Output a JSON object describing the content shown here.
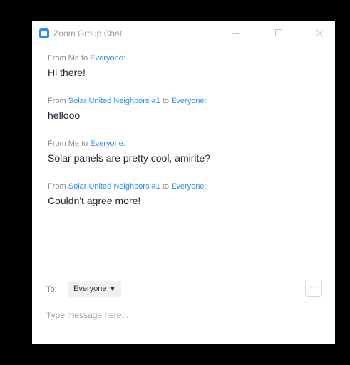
{
  "window": {
    "title": "Zoom Group Chat",
    "accent": "#2D8CFF"
  },
  "messages": [
    {
      "prefix": "From",
      "sender": "Me",
      "joiner": "to",
      "recipient": "Everyone:",
      "text": "Hi there!"
    },
    {
      "prefix": "From",
      "sender": "Solar United Neighbors #1",
      "joiner": "to",
      "recipient": "Everyone:",
      "text": "hellooo"
    },
    {
      "prefix": "From",
      "sender": "Me",
      "joiner": "to",
      "recipient": "Everyone:",
      "text": "Solar panels are pretty cool, amirite?"
    },
    {
      "prefix": "From",
      "sender": "Solar United Neighbors #1",
      "joiner": "to",
      "recipient": "Everyone:",
      "text": "Couldn't agree more!"
    }
  ],
  "composer": {
    "to_label": "To:",
    "recipient": "Everyone",
    "more_icon": "ellipsis-icon",
    "more_label": "···",
    "placeholder": "Type message here..."
  }
}
